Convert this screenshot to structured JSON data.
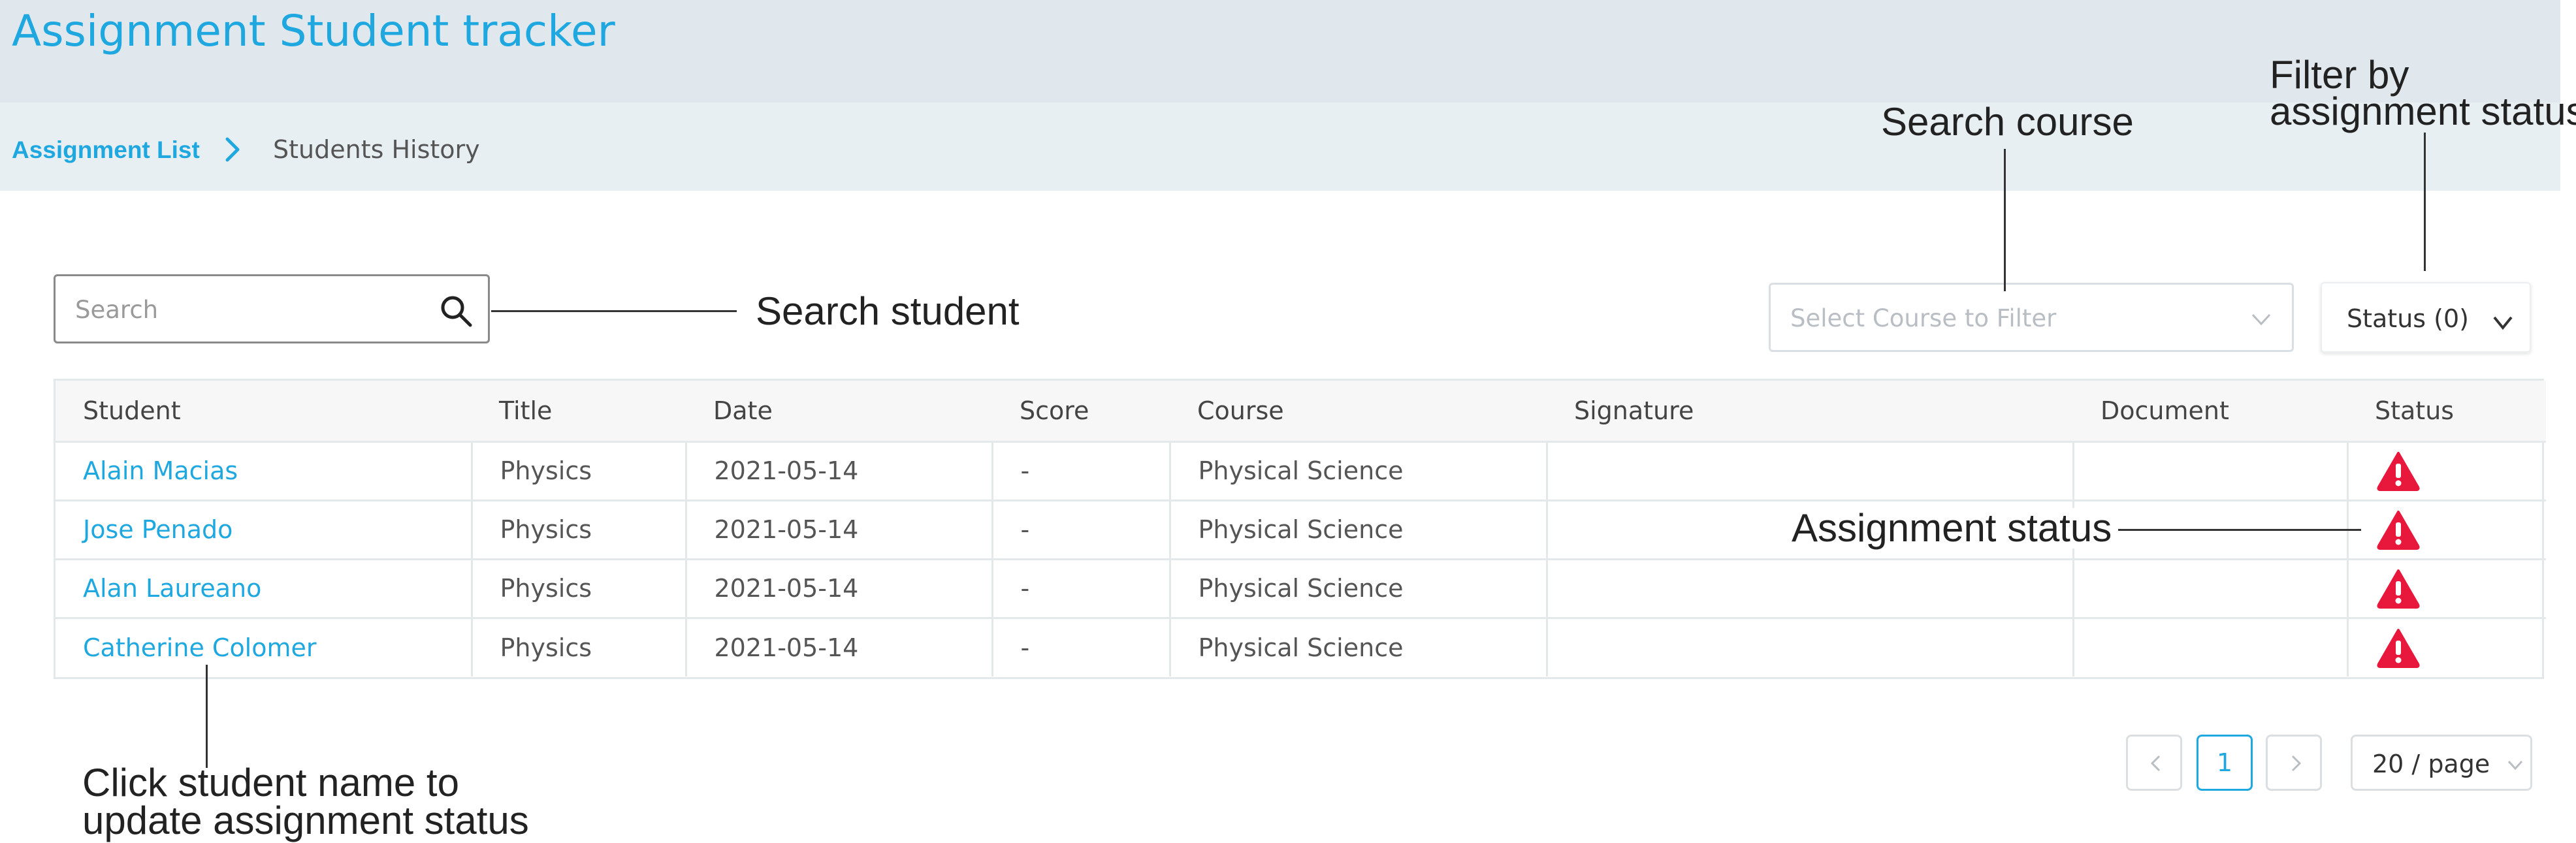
{
  "header": {
    "title": "Assignment Student tracker"
  },
  "breadcrumb": {
    "parent": "Assignment List",
    "current": "Students History"
  },
  "search": {
    "placeholder": "Search"
  },
  "course_filter": {
    "placeholder": "Select Course to Filter"
  },
  "status_filter": {
    "label": "Status (0)"
  },
  "table": {
    "columns": [
      "Student",
      "Title",
      "Date",
      "Score",
      "Course",
      "Signature",
      "Document",
      "Status"
    ],
    "rows": [
      {
        "student": "Alain Macias",
        "title": "Physics",
        "date": "2021-05-14",
        "score": "-",
        "course": "Physical Science",
        "signature": "",
        "document": "",
        "status": "warning"
      },
      {
        "student": "Jose Penado",
        "title": "Physics",
        "date": "2021-05-14",
        "score": "-",
        "course": "Physical Science",
        "signature": "",
        "document": "",
        "status": "warning"
      },
      {
        "student": "Alan Laureano",
        "title": "Physics",
        "date": "2021-05-14",
        "score": "-",
        "course": "Physical Science",
        "signature": "",
        "document": "",
        "status": "warning"
      },
      {
        "student": "Catherine Colomer",
        "title": "Physics",
        "date": "2021-05-14",
        "score": "-",
        "course": "Physical Science",
        "signature": "",
        "document": "",
        "status": "warning"
      }
    ]
  },
  "pagination": {
    "current_page": "1",
    "page_size": "20 / page"
  },
  "annotations": {
    "search_student": "Search student",
    "search_course": "Search course",
    "filter_status_line1": "Filter by",
    "filter_status_line2": "assignment status",
    "assignment_status": "Assignment status",
    "click_student_line1": "Click student name to",
    "click_student_line2": "update assignment status"
  },
  "colors": {
    "accent": "#1fa8e0",
    "warning": "#e8173c",
    "header_bg": "#e0e8ed"
  },
  "icons": {
    "search": "search-icon",
    "status": "warning-triangle-icon",
    "dropdown": "chevron-down-icon"
  }
}
